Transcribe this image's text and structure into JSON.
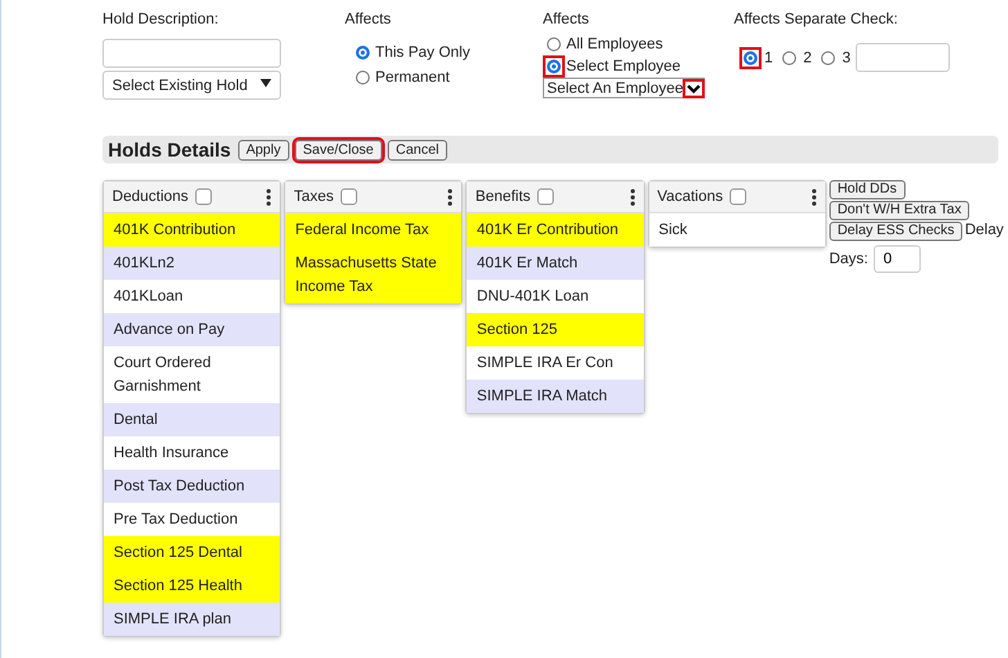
{
  "hold_description": {
    "label": "Hold Description:",
    "dropdown": "Select Existing Hold"
  },
  "affects_pay": {
    "label": "Affects",
    "options": [
      {
        "label": "This Pay Only",
        "selected": true,
        "highlighted": false
      },
      {
        "label": "Permanent",
        "selected": false,
        "highlighted": false
      }
    ]
  },
  "affects_employee": {
    "label": "Affects",
    "options": [
      {
        "label": "All Employees",
        "selected": false,
        "highlighted": false
      },
      {
        "label": "Select Employee",
        "selected": true,
        "highlighted": true
      }
    ],
    "dropdown": "Select An Employee",
    "dropdown_arrow_highlighted": true
  },
  "separate_check": {
    "label": "Affects Separate Check:",
    "options": [
      {
        "label": "1",
        "selected": true,
        "highlighted": true
      },
      {
        "label": "2",
        "selected": false,
        "highlighted": false
      },
      {
        "label": "3",
        "selected": false,
        "highlighted": false
      }
    ]
  },
  "holds_details": {
    "title": "Holds Details",
    "buttons": [
      {
        "label": "Apply",
        "highlighted": false
      },
      {
        "label": "Save/Close",
        "highlighted": true
      },
      {
        "label": "Cancel",
        "highlighted": false
      }
    ]
  },
  "panels": [
    {
      "title": "Deductions",
      "checked": false,
      "items": [
        {
          "label": "401K Contribution",
          "selected": true
        },
        {
          "label": "401KLn2",
          "selected": false
        },
        {
          "label": "401KLoan",
          "selected": false
        },
        {
          "label": "Advance on Pay",
          "selected": false
        },
        {
          "label": "Court Ordered Garnishment",
          "selected": false
        },
        {
          "label": "Dental",
          "selected": false
        },
        {
          "label": "Health Insurance",
          "selected": false
        },
        {
          "label": "Post Tax Deduction",
          "selected": false
        },
        {
          "label": "Pre Tax Deduction",
          "selected": false
        },
        {
          "label": "Section 125 Dental",
          "selected": true
        },
        {
          "label": "Section 125 Health",
          "selected": true
        },
        {
          "label": "SIMPLE IRA plan",
          "selected": false
        }
      ]
    },
    {
      "title": "Taxes",
      "checked": false,
      "items": [
        {
          "label": "Federal Income Tax",
          "selected": true
        },
        {
          "label": "Massachusetts State Income Tax",
          "selected": true
        }
      ]
    },
    {
      "title": "Benefits",
      "checked": false,
      "items": [
        {
          "label": "401K Er Contribution",
          "selected": true
        },
        {
          "label": "401K Er Match",
          "selected": false
        },
        {
          "label": "DNU-401K Loan",
          "selected": false
        },
        {
          "label": "Section 125",
          "selected": true
        },
        {
          "label": "SIMPLE IRA Er Con",
          "selected": false
        },
        {
          "label": "SIMPLE IRA Match",
          "selected": false
        }
      ]
    },
    {
      "title": "Vacations",
      "checked": false,
      "items": [
        {
          "label": "Sick",
          "selected": false
        }
      ]
    }
  ],
  "side_buttons": [
    "Hold DDs",
    "Don't W/H Extra Tax",
    "Delay ESS Checks"
  ],
  "delay_label": "Delay",
  "days_label": "Days:",
  "days_value": "0"
}
